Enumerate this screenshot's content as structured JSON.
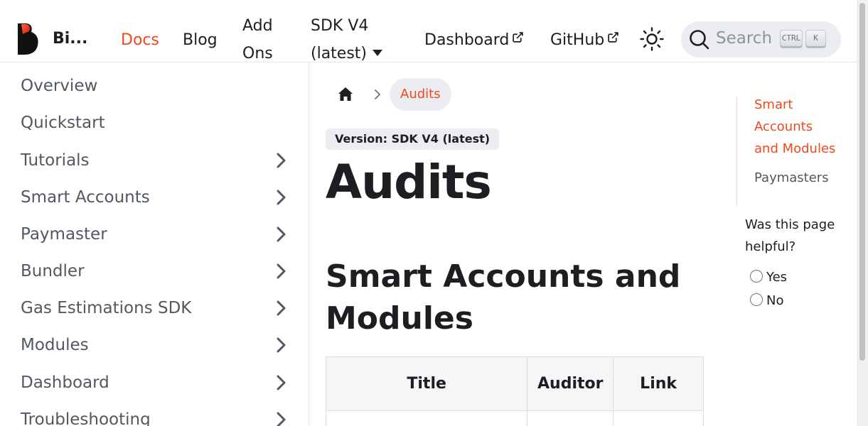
{
  "header": {
    "brand": "Bi...",
    "nav": {
      "docs": "Docs",
      "blog": "Blog",
      "add_ons_line1": "Add",
      "add_ons_line2": "Ons",
      "sdk_line1": "SDK V4",
      "sdk_line2": "(latest)",
      "dashboard": "Dashboard",
      "github": "GitHub"
    },
    "search": {
      "placeholder": "Search",
      "key1": "CTRL",
      "key2": "K"
    }
  },
  "sidebar": {
    "items": [
      {
        "label": "Overview"
      },
      {
        "label": "Quickstart"
      },
      {
        "label": "Tutorials"
      },
      {
        "label": "Smart Accounts"
      },
      {
        "label": "Paymaster"
      },
      {
        "label": "Bundler"
      },
      {
        "label": "Gas Estimations SDK"
      },
      {
        "label": "Modules"
      },
      {
        "label": "Dashboard"
      },
      {
        "label": "Troubleshooting"
      }
    ]
  },
  "breadcrumb": {
    "current": "Audits"
  },
  "main": {
    "version_badge": "Version: SDK V4 (latest)",
    "title": "Audits",
    "section_title": "Smart Accounts and Modules",
    "table": {
      "headers": [
        "Title",
        "Auditor",
        "Link"
      ]
    }
  },
  "toc": {
    "items": [
      {
        "label": "Smart Accounts and Modules"
      },
      {
        "label": "Paymasters"
      }
    ]
  },
  "feedback": {
    "question": "Was this page helpful?",
    "yes": "Yes",
    "no": "No"
  },
  "colors": {
    "accent": "#f0481f",
    "text": "#1c1e21",
    "muted": "#525860",
    "chip_bg": "#ebedf0"
  },
  "icons": [
    "biconomy-logo",
    "external-link-icon",
    "sun-icon",
    "search-icon",
    "home-icon",
    "chevron-right-icon",
    "caret-down-icon"
  ]
}
